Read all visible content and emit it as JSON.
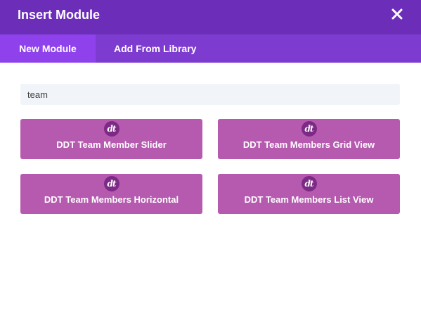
{
  "modal": {
    "title": "Insert Module",
    "close_icon": "close-icon"
  },
  "tabs": [
    {
      "label": "New Module",
      "active": true
    },
    {
      "label": "Add From Library",
      "active": false
    }
  ],
  "search": {
    "value": "team"
  },
  "modules": [
    {
      "label": "DDT Team Member Slider",
      "icon": "ddt-logo-icon",
      "icon_text": "dt"
    },
    {
      "label": "DDT Team Members Grid View",
      "icon": "ddt-logo-icon",
      "icon_text": "dt"
    },
    {
      "label": "DDT Team Members Horizontal",
      "icon": "ddt-logo-icon",
      "icon_text": "dt"
    },
    {
      "label": "DDT Team Members List View",
      "icon": "ddt-logo-icon",
      "icon_text": "dt"
    }
  ],
  "colors": {
    "header": "#6c2eb9",
    "tabs_bar": "#7e3bd0",
    "active_tab": "#8f42ec",
    "module_button": "#b55aaf",
    "module_icon": "#7d2a86",
    "search_bg": "#f1f5f9"
  }
}
